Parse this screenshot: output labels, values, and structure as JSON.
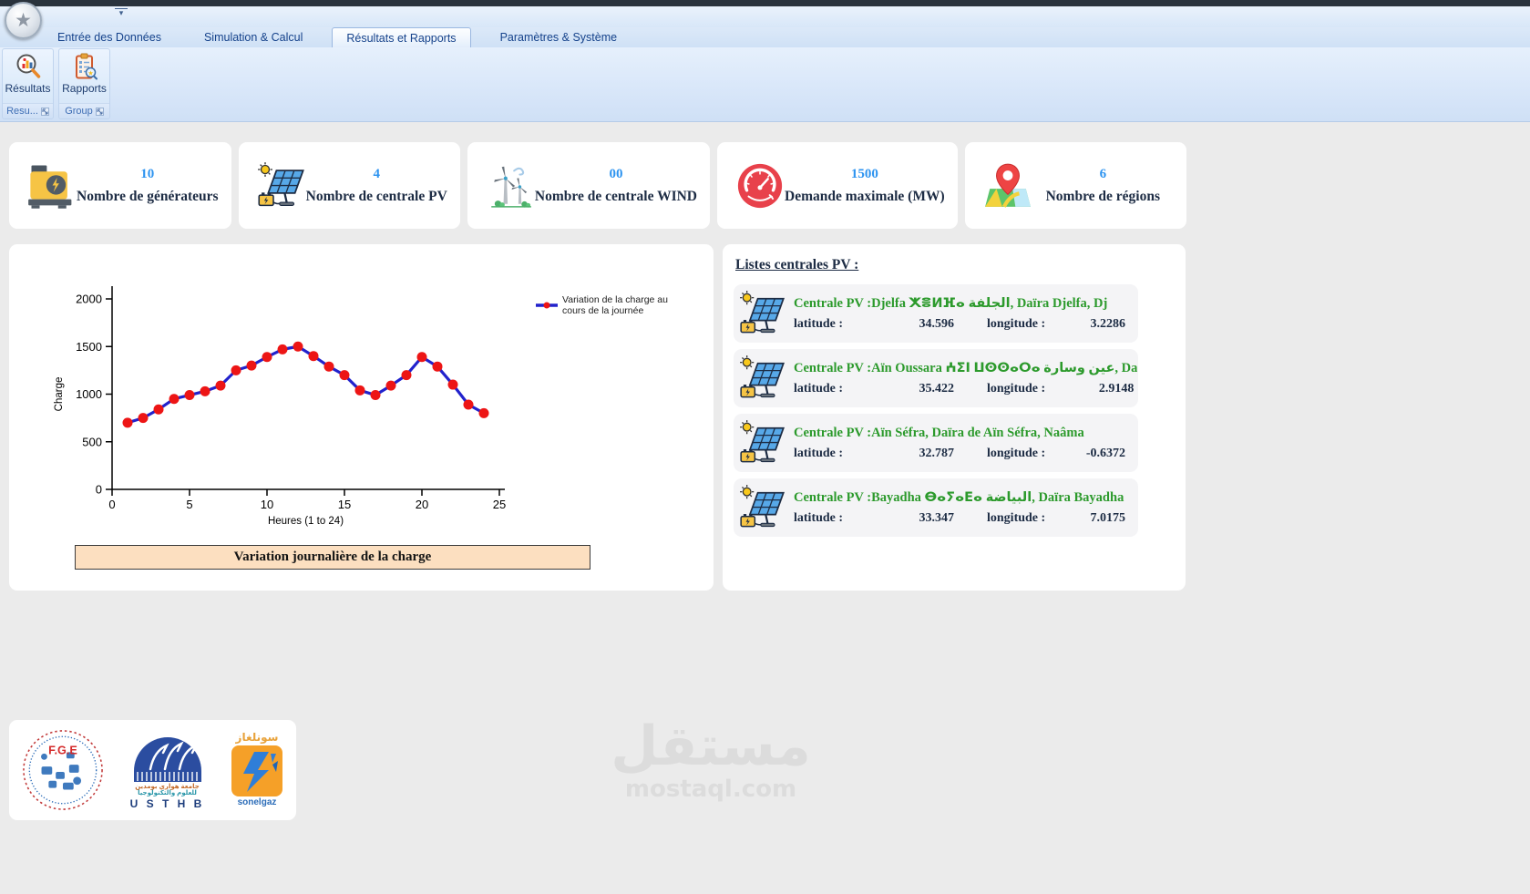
{
  "ribbon": {
    "tabs": [
      {
        "label": "Entrée des Données",
        "active": false
      },
      {
        "label": "Simulation & Calcul",
        "active": false
      },
      {
        "label": "Résultats et Rapports",
        "active": true
      },
      {
        "label": "Paramètres & Système",
        "active": false
      }
    ],
    "buttons": [
      {
        "label": "Résultats",
        "icon": "magnifier-chart-icon"
      },
      {
        "label": "Rapports",
        "icon": "report-clipboard-icon"
      }
    ],
    "groups": [
      {
        "label": "Resu..."
      },
      {
        "label": "Group"
      }
    ],
    "qat_arrow": "▾"
  },
  "stats": [
    {
      "icon": "generator-icon",
      "value": "10",
      "label": "Nombre de générateurs"
    },
    {
      "icon": "solar-panel-icon",
      "value": "4",
      "label": "Nombre de centrale PV"
    },
    {
      "icon": "wind-turbine-icon",
      "value": "00",
      "label": "Nombre de centrale WIND"
    },
    {
      "icon": "gauge-icon",
      "value": "1500",
      "label": "Demande maximale (MW)"
    },
    {
      "icon": "map-pin-icon",
      "value": "6",
      "label": "Nombre de régions"
    }
  ],
  "chart_data": {
    "type": "line",
    "x": [
      1,
      2,
      3,
      4,
      5,
      6,
      7,
      8,
      9,
      10,
      11,
      12,
      13,
      14,
      15,
      16,
      17,
      18,
      19,
      20,
      21,
      22,
      23,
      24
    ],
    "values": [
      700,
      750,
      840,
      950,
      990,
      1030,
      1090,
      1250,
      1300,
      1390,
      1470,
      1500,
      1400,
      1290,
      1200,
      1040,
      990,
      1090,
      1200,
      1390,
      1290,
      1100,
      890,
      800
    ],
    "title": "",
    "xlabel": "Heures (1 to 24)",
    "ylabel": "Charge",
    "xlim": [
      0,
      25
    ],
    "ylim": [
      0,
      2000
    ],
    "xticks": [
      0,
      5,
      10,
      15,
      20,
      25
    ],
    "yticks": [
      0,
      500,
      1000,
      1500,
      2000
    ],
    "legend_lines": [
      "Variation de la charge au",
      "cours de la journée"
    ],
    "legend_position": "top-right",
    "grid": false,
    "line_color": "#2222cc",
    "marker_color": "#ed1515",
    "caption": "Variation journalière de la charge"
  },
  "pv_list": {
    "title": "Listes centrales PV :",
    "lat_label": "latitude :",
    "lon_label": "longitude :",
    "items": [
      {
        "name": "Centrale PV :Djelfa ⵅⴻⵍⴼⴰ الجلفة, Daïra Djelfa, Dj",
        "lat": "34.596",
        "lon": "3.2286"
      },
      {
        "name": "Centrale PV :Aïn Oussara ⵄⵉⵏ ⵡⵙⵙⴰⵔⴰ عين وسارة, Da",
        "lat": "35.422",
        "lon": "2.9148"
      },
      {
        "name": "Centrale PV :Aïn Séfra, Daïra de Aïn Séfra, Naâma",
        "lat": "32.787",
        "lon": "-0.6372"
      },
      {
        "name": "Centrale PV :Bayadha ⴱⴰⵢⴰⴹⴰ البياضة, Daïra Bayadha",
        "lat": "33.347",
        "lon": "7.0175"
      }
    ]
  },
  "logos": {
    "fge_text": "F.G.E",
    "usthb_ar1": "جامعة هواري بومدين",
    "usthb_ar2": "للعلوم والتكنولوجيا",
    "usthb_text": "U S T H B",
    "sonelgaz_ar": "سونلغاز",
    "sonelgaz_text": "sonelgaz"
  },
  "watermark": {
    "ar": "مستقل",
    "en": "mostaql.com"
  },
  "colors": {
    "accent_blue": "#2e94f0",
    "pv_green": "#2c9a2c",
    "caption_bg": "#fcdfc0",
    "ribbon_text": "#15428b",
    "demand_red": "#e8414b"
  }
}
